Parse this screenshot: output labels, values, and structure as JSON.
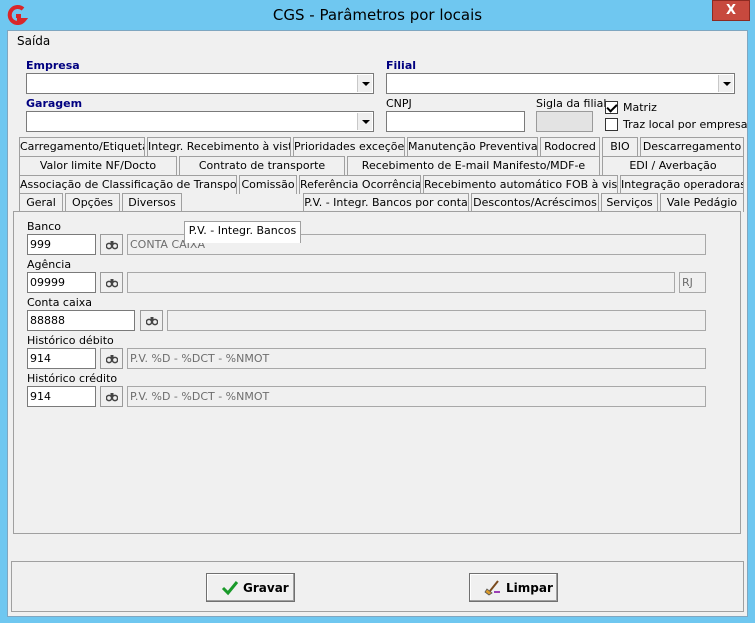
{
  "window": {
    "title": "CGS - Parâmetros por locais",
    "close": "X"
  },
  "menu": {
    "items": [
      {
        "label": "Saída"
      }
    ]
  },
  "form": {
    "empresa_label": "Empresa",
    "filial_label": "Filial",
    "garagem_label": "Garagem",
    "cnpj_label": "CNPJ",
    "sigla_label": "Sigla da filial",
    "matriz_label": "Matriz",
    "matriz_checked": true,
    "traz_local_label": "Traz local por empresa",
    "traz_local_checked": false
  },
  "tabs": {
    "row1": [
      "Carregamento/Etiquetas",
      "Integr. Recebimento à vista",
      "Prioridades exceções",
      "Manutenção Preventiva",
      "Rodocred",
      "BIO",
      "Descarregamento"
    ],
    "row2": [
      "Valor limite NF/Docto",
      "Contrato de transporte",
      "Recebimento de E-mail Manifesto/MDF-e",
      "EDI / Averbação"
    ],
    "row3": [
      "Associação de Classificação de Transporte",
      "Comissão",
      "Referência Ocorrência",
      "Recebimento automático FOB à vista",
      "Integração operadoras"
    ],
    "row4": [
      "Geral",
      "Opções",
      "Diversos",
      "P.V. - Integr. Bancos",
      "P.V. - Integr. Bancos por conta",
      "Descontos/Acréscimos",
      "Serviços",
      "Vale Pedágio"
    ],
    "active": "P.V. - Integr. Bancos"
  },
  "panel": {
    "banco_label": "Banco",
    "banco_code": "999",
    "banco_desc": "CONTA CAIXA",
    "agencia_label": "Agência",
    "agencia_code": "09999",
    "agencia_desc": "",
    "agencia_uf": "RJ",
    "conta_label": "Conta caixa",
    "conta_code": "88888",
    "conta_desc": "",
    "hist_debito_label": "Histórico débito",
    "hist_debito_code": "914",
    "hist_debito_desc": "P.V. %D - %DCT - %NMOT",
    "hist_credito_label": "Histórico crédito",
    "hist_credito_code": "914",
    "hist_credito_desc": "P.V. %D - %DCT - %NMOT"
  },
  "buttons": {
    "gravar": "Gravar",
    "limpar": "Limpar"
  },
  "icons": {
    "app": "app-logo-icon",
    "lookup": "binoculars-icon",
    "save": "checkmark-icon",
    "clear": "broom-icon"
  }
}
